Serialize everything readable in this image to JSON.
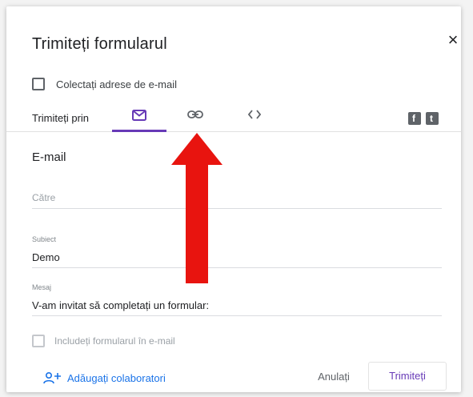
{
  "dialog": {
    "title": "Trimiteți formularul",
    "close_glyph": "×",
    "collect_emails_label": "Colectați adrese de e-mail"
  },
  "send_via": {
    "label": "Trimiteți prin",
    "tabs": [
      {
        "icon": "email-icon",
        "active": true
      },
      {
        "icon": "link-icon",
        "active": false
      },
      {
        "icon": "embed-code-icon",
        "active": false
      }
    ],
    "social": [
      {
        "icon": "facebook-icon",
        "glyph": "f"
      },
      {
        "icon": "twitter-icon",
        "glyph": "t"
      }
    ]
  },
  "email_form": {
    "section_title": "E-mail",
    "to_placeholder": "Către",
    "subject_label": "Subiect",
    "subject_value": "Demo",
    "message_label": "Mesaj",
    "message_value": "V-am invitat să completați un formular:",
    "include_form_label": "Includeți formularul în e-mail"
  },
  "footer": {
    "add_collaborators_label": "Adăugați colaboratori",
    "cancel_label": "Anulați",
    "send_label": "Trimiteți"
  },
  "colors": {
    "accent": "#673ab7",
    "link": "#1a73e8",
    "annotation_arrow": "#e8140f"
  }
}
